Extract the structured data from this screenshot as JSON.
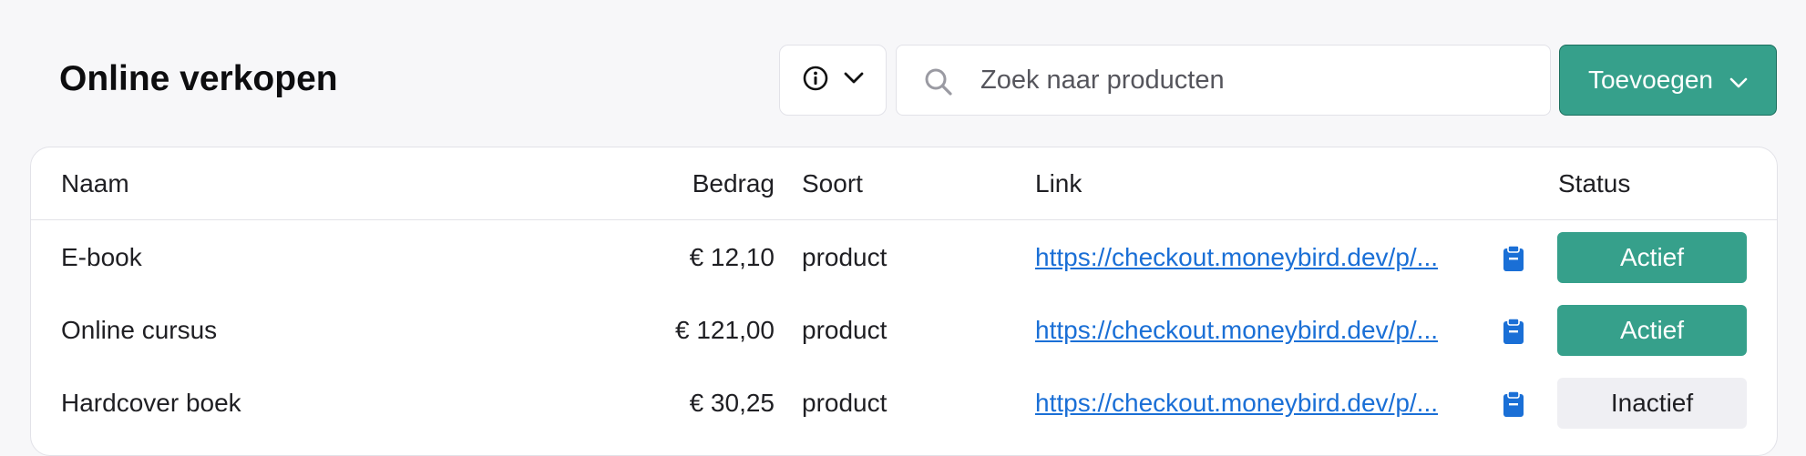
{
  "header": {
    "title": "Online verkopen",
    "info_icon": "info-circle-icon",
    "chevron_icon": "chevron-down-icon",
    "search": {
      "placeholder": "Zoek naar producten",
      "value": "",
      "icon": "search-icon"
    },
    "add_button": {
      "label": "Toevoegen"
    }
  },
  "table": {
    "columns": {
      "name": "Naam",
      "amount": "Bedrag",
      "type": "Soort",
      "link": "Link",
      "status": "Status"
    },
    "rows": [
      {
        "name": "E-book",
        "amount": "€ 12,10",
        "type": "product",
        "link": "https://checkout.moneybird.dev/p/...",
        "status": "Actief"
      },
      {
        "name": "Online cursus",
        "amount": "€ 121,00",
        "type": "product",
        "link": "https://checkout.moneybird.dev/p/...",
        "status": "Actief"
      },
      {
        "name": "Hardcover boek",
        "amount": "€ 30,25",
        "type": "product",
        "link": "https://checkout.moneybird.dev/p/...",
        "status": "Inactief"
      }
    ]
  },
  "colors": {
    "accent": "#36a08b",
    "link": "#1a6fd6",
    "inactive_bg": "#efeff3"
  }
}
